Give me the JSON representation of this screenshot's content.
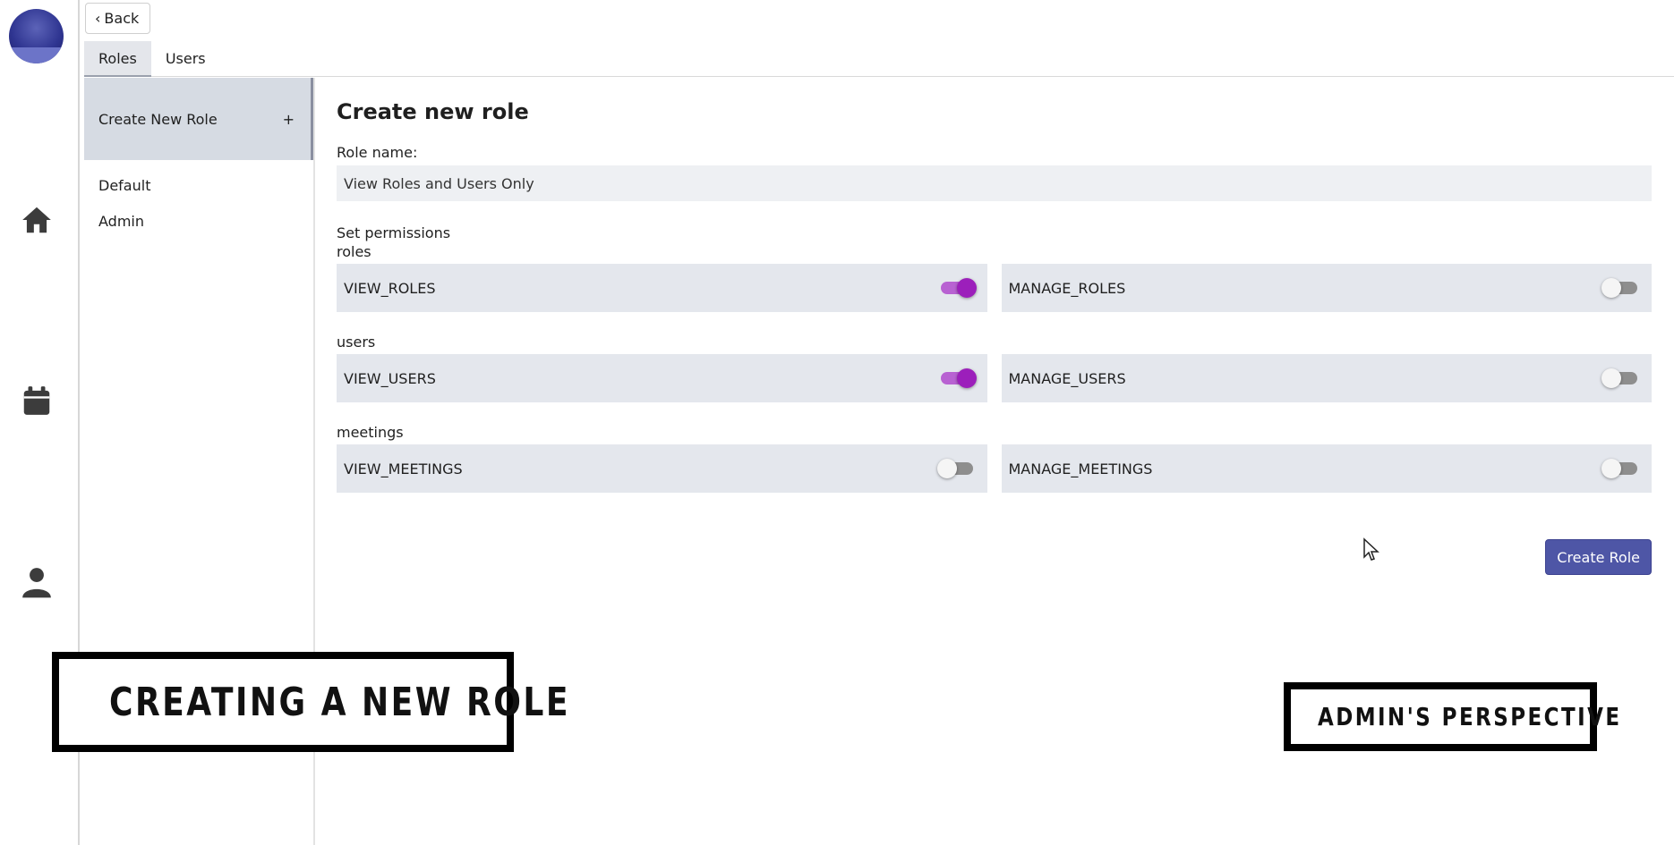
{
  "nav": {
    "back_label": "Back",
    "tabs": [
      {
        "label": "Roles",
        "active": true
      },
      {
        "label": "Users",
        "active": false
      }
    ]
  },
  "rail": {
    "icons": [
      "app-logo",
      "home-icon",
      "calendar-icon",
      "user-icon"
    ]
  },
  "role_list": {
    "create_label": "Create New Role",
    "create_icon": "+",
    "roles": [
      "Default",
      "Admin"
    ]
  },
  "form": {
    "title": "Create new role",
    "role_name_label": "Role name:",
    "role_name_value": "View Roles and Users Only",
    "permissions_label": "Set permissions",
    "groups": [
      {
        "label": "roles",
        "perms": [
          {
            "name": "VIEW_ROLES",
            "enabled": true
          },
          {
            "name": "MANAGE_ROLES",
            "enabled": false
          }
        ]
      },
      {
        "label": "users",
        "perms": [
          {
            "name": "VIEW_USERS",
            "enabled": true
          },
          {
            "name": "MANAGE_USERS",
            "enabled": false
          }
        ]
      },
      {
        "label": "meetings",
        "perms": [
          {
            "name": "VIEW_MEETINGS",
            "enabled": false
          },
          {
            "name": "MANAGE_MEETINGS",
            "enabled": false
          }
        ]
      }
    ],
    "submit_label": "Create Role"
  },
  "overlays": {
    "left_banner": "Creating a new role",
    "right_banner": "Admin's perspective"
  },
  "colors": {
    "accent": "#4e56a6",
    "toggle_on": "#9c1fbb",
    "panel": "#e4e7ed"
  }
}
